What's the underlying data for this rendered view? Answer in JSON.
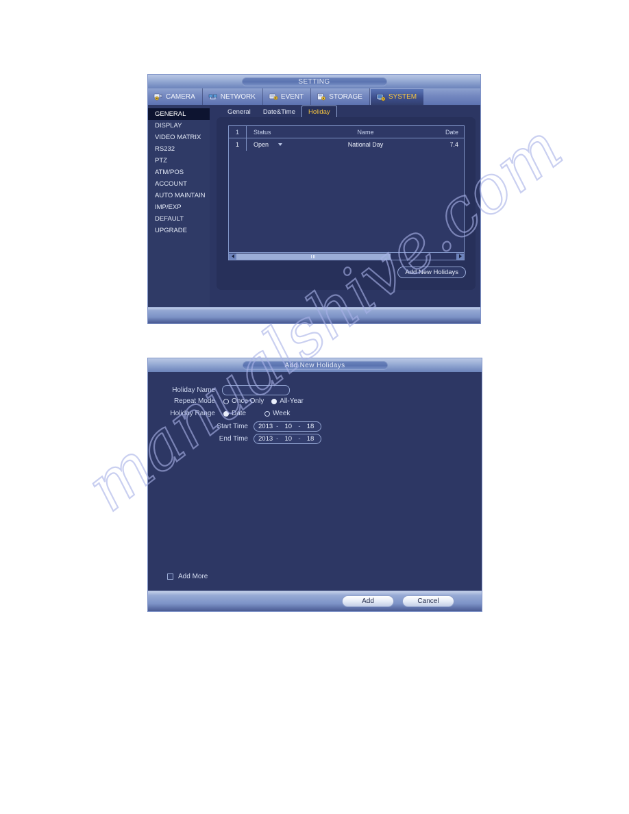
{
  "window_setting": {
    "title": "SETTING",
    "tabs": [
      {
        "label": "CAMERA",
        "icon": "camera-icon",
        "active": false
      },
      {
        "label": "NETWORK",
        "icon": "network-icon",
        "active": false
      },
      {
        "label": "EVENT",
        "icon": "event-icon",
        "active": false
      },
      {
        "label": "STORAGE",
        "icon": "storage-icon",
        "active": false
      },
      {
        "label": "SYSTEM",
        "icon": "system-icon",
        "active": true
      }
    ],
    "sidebar": [
      {
        "label": "GENERAL",
        "active": true
      },
      {
        "label": "DISPLAY",
        "active": false
      },
      {
        "label": "VIDEO MATRIX",
        "active": false
      },
      {
        "label": "RS232",
        "active": false
      },
      {
        "label": "PTZ",
        "active": false
      },
      {
        "label": "ATM/POS",
        "active": false
      },
      {
        "label": "ACCOUNT",
        "active": false
      },
      {
        "label": "AUTO MAINTAIN",
        "active": false
      },
      {
        "label": "IMP/EXP",
        "active": false
      },
      {
        "label": "DEFAULT",
        "active": false
      },
      {
        "label": "UPGRADE",
        "active": false
      }
    ],
    "subtabs": [
      {
        "label": "General",
        "active": false
      },
      {
        "label": "Date&Time",
        "active": false
      },
      {
        "label": "Holiday",
        "active": true
      }
    ],
    "table": {
      "headers": {
        "index": "1",
        "status": "Status",
        "name": "Name",
        "date": "Date"
      },
      "rows": [
        {
          "index": "1",
          "status": "Open",
          "name": "National Day",
          "date": "7.4"
        }
      ]
    },
    "add_new_holidays_button": "Add New Holidays"
  },
  "window_add_holiday": {
    "title": "Add New Holidays",
    "fields": {
      "holiday_name_label": "Holiday Name",
      "holiday_name_value": "",
      "repeat_mode_label": "Repeat Mode",
      "repeat_once_only": "Once Only",
      "repeat_all_year": "All-Year",
      "holiday_range_label": "Holiday Range",
      "range_date": "Date",
      "range_week": "Week",
      "start_time_label": "Start Time",
      "end_time_label": "End Time",
      "start_time": {
        "year": "2013",
        "month": "10",
        "day": "18"
      },
      "end_time": {
        "year": "2013",
        "month": "10",
        "day": "18"
      },
      "add_more_label": "Add More"
    },
    "buttons": {
      "add": "Add",
      "cancel": "Cancel"
    }
  },
  "watermark": {
    "text": "manualshive.com"
  },
  "colors": {
    "accent_gold": "#f5c441",
    "window_bg": "#2c3663",
    "panel_bg": "#27305a",
    "border": "#8094c6",
    "titlebar_light": "#9aaed6"
  }
}
